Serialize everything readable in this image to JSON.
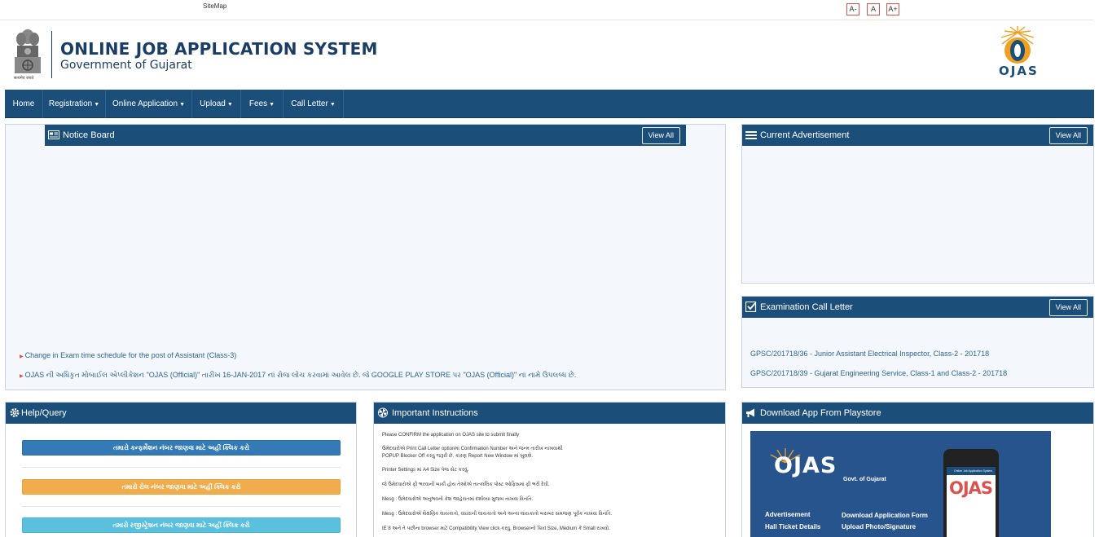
{
  "topbar": {
    "sitemap": "SiteMap",
    "font_sizes": [
      "A-",
      "A",
      "A+"
    ]
  },
  "header": {
    "title": "ONLINE JOB APPLICATION SYSTEM",
    "subtitle": "Government of Gujarat",
    "emblem_caption": "सत्यमेव जयते",
    "logo_text": "OJAS"
  },
  "nav": {
    "items": [
      "Home",
      "Registration",
      "Online Application",
      "Upload",
      "Fees",
      "Call Letter"
    ]
  },
  "notice_board": {
    "title": "Notice Board",
    "view_all": "View All",
    "items": [
      "Change in Exam time schedule for the post of Assistant (Class-3)",
      "OJAS ની અધિકૃત મોબાઈલ એપ્લીકેશન \"OJAS (Official)\" તારીખ 16-JAN-2017 નાં રોજ લોંચ કરવામાં આવેલ છે. જે GOOGLE PLAY STORE પર \"OJAS (Official)\" નાં નામે ઉપલબ્ધ છે."
    ]
  },
  "current_ad": {
    "title": "Current Advertisement",
    "view_all": "View All"
  },
  "exam_call_letter": {
    "title": "Examination Call Letter",
    "view_all": "View All",
    "items": [
      "GPSC/201718/36 - Junior Assistant Electrical Inspector, Class-2 - 201718",
      "GPSC/201718/39 - Gujarat Engineering Service, Class-1 and Class-2 - 201718"
    ]
  },
  "help": {
    "title": "Help/Query",
    "buttons": [
      {
        "label": "તમારો કન્ફર્મેશન નંબર જાણવા માટે અહીં ક્લિક કરો",
        "color": "#337ab7"
      },
      {
        "label": "તમારો રોલ નંબર જાણવા માટે અહીં ક્લિક કરો",
        "color": "#f0ad4e"
      },
      {
        "label": "તમારો રજીસ્ટ્રેશન નંબર જાણવા માટે અહીં ક્લિક કરો",
        "color": "#5bc0de"
      }
    ]
  },
  "instructions": {
    "title": "Important Instructions",
    "lines": [
      "Please CONFIRM the application on OJAS site to submit finally",
      "ઉમેદવારોએ Print Call Letter optionમાં Confirmation Number અને જન્મ તારીખ નાખવાથી",
      "POPUP Blocker Off કરવુ જરૂરી છે. કારણ Report New Window માં ખુલશે.",
      "Printer Settings માં A4 Size પેજ સેટ કરવું.",
      "જે ઉમેદવારોએ ફી ભરવાની બાકી હોય તેઓએ તાત્કાલિક પોસ્ટ ઓફિસમાં ફી ભરી દેવી.",
      "Mesg : ઉમેદવારોએ અનુભવનો કેશ જાહેરાતમાં દર્શાવ્યા મુજબ નાખવા વિનંતિ.",
      "Mesg : ઉમેદવારોએ શૈક્ષણિક લાયકાતો, વધારાની લાયકાતો અને અન્ય લાયકાતો બરાબર સમજણ પૂર્વક નાખવા વિનંતિ.",
      "IE 8 અને તે પછીના browser માટે Compatibility View click કરવુ. Browserનો Text Size, Medium કે Small રાખવો."
    ]
  },
  "download": {
    "title": "Download App From Playstore",
    "banner": {
      "logo": "OJAS",
      "gov": "Govt. of Gujarat",
      "left_lines": [
        "Advertisement",
        "Hall Ticket Details"
      ],
      "right_lines": [
        "Download Application Form",
        "Upload Photo/Signature"
      ],
      "phone_title": "Online Job Application System",
      "phone_logo": "OJAS"
    }
  },
  "colors": {
    "nav_bg": "#1c4e7a",
    "panel_bg": "#f4f7fb",
    "link": "#2a6496"
  }
}
